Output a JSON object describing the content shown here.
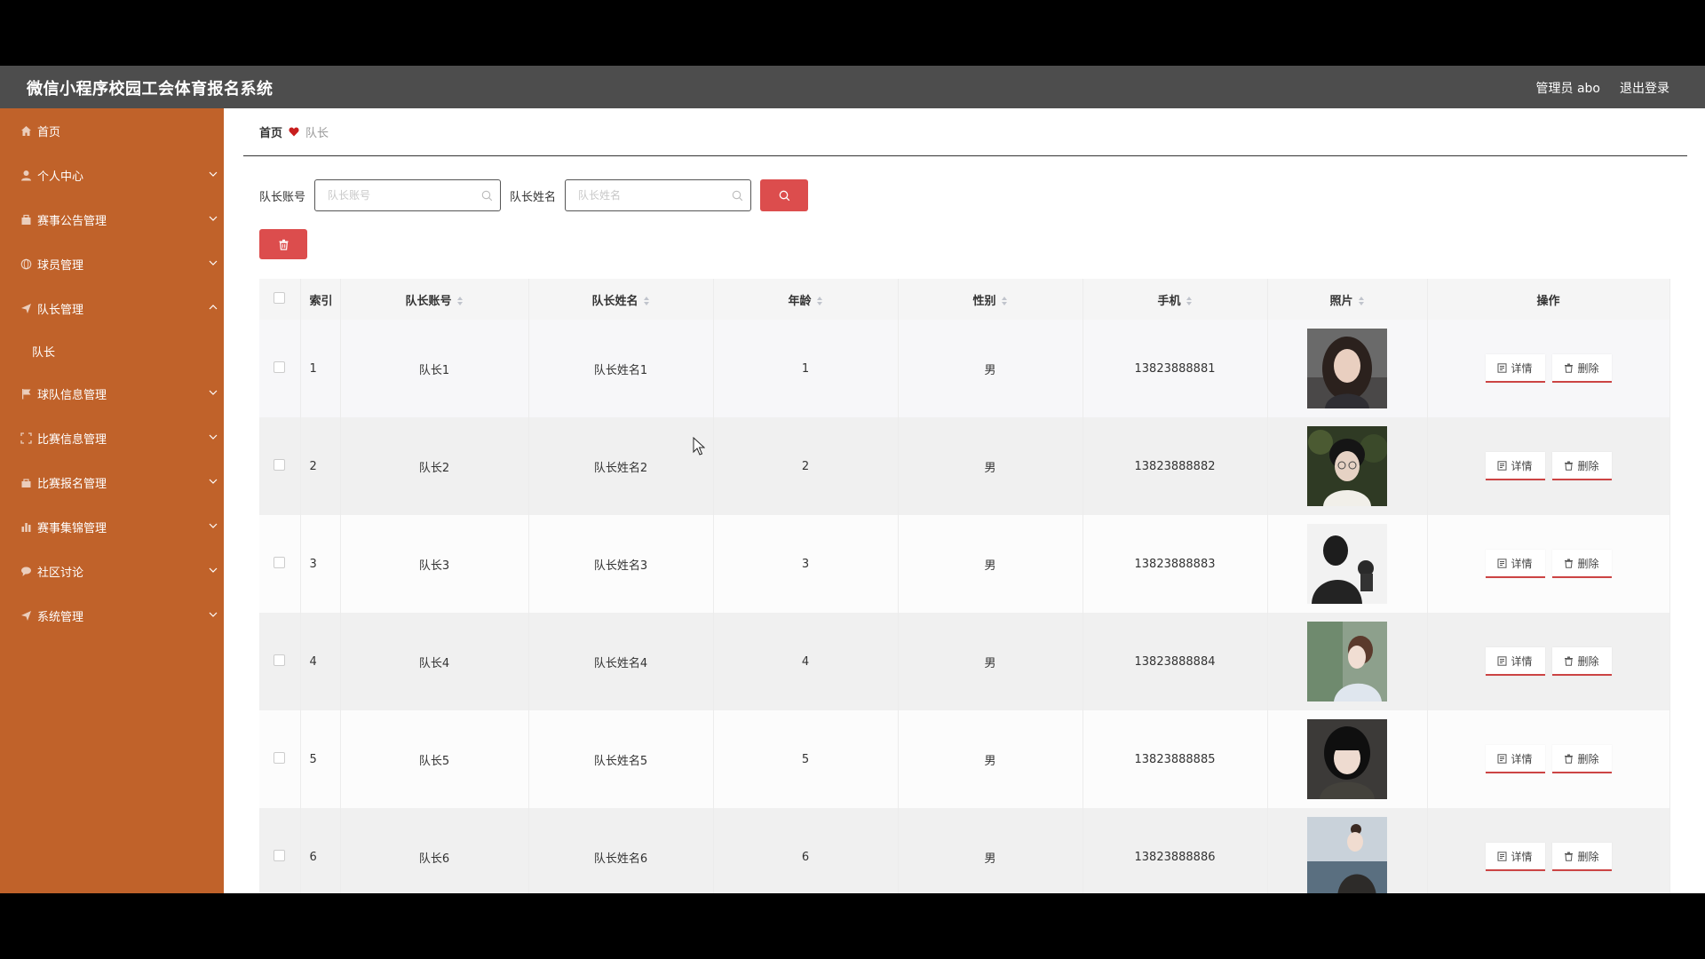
{
  "header": {
    "title": "微信小程序校园工会体育报名系统",
    "admin": "管理员 abo",
    "logout": "退出登录"
  },
  "sidebar": {
    "items": [
      {
        "label": "首页",
        "icon": "home-icon",
        "chevron": false
      },
      {
        "label": "个人中心",
        "icon": "user-icon",
        "chevron": true
      },
      {
        "label": "赛事公告管理",
        "icon": "bag-icon",
        "chevron": true
      },
      {
        "label": "球员管理",
        "icon": "globe-icon",
        "chevron": true
      },
      {
        "label": "队长管理",
        "icon": "send-icon",
        "chevron": true,
        "open": true
      },
      {
        "label": "球队信息管理",
        "icon": "flag-icon",
        "chevron": true
      },
      {
        "label": "比赛信息管理",
        "icon": "fullscreen-icon",
        "chevron": true
      },
      {
        "label": "比赛报名管理",
        "icon": "bag-icon",
        "chevron": true
      },
      {
        "label": "赛事集锦管理",
        "icon": "chart-icon",
        "chevron": true
      },
      {
        "label": "社区讨论",
        "icon": "chat-icon",
        "chevron": true
      },
      {
        "label": "系统管理",
        "icon": "send-icon",
        "chevron": true
      }
    ],
    "sub_item": "队长"
  },
  "breadcrumb": {
    "home": "首页",
    "current": "队长"
  },
  "search": {
    "account_label": "队长账号",
    "account_placeholder": "队长账号",
    "name_label": "队长姓名",
    "name_placeholder": "队长姓名"
  },
  "table": {
    "headers": [
      "索引",
      "队长账号",
      "队长姓名",
      "年龄",
      "性别",
      "手机",
      "照片",
      "操作"
    ],
    "rows": [
      {
        "index": "1",
        "account": "队长1",
        "name": "队长姓名1",
        "age": "1",
        "gender": "男",
        "phone": "13823888881"
      },
      {
        "index": "2",
        "account": "队长2",
        "name": "队长姓名2",
        "age": "2",
        "gender": "男",
        "phone": "13823888882"
      },
      {
        "index": "3",
        "account": "队长3",
        "name": "队长姓名3",
        "age": "3",
        "gender": "男",
        "phone": "13823888883"
      },
      {
        "index": "4",
        "account": "队长4",
        "name": "队长姓名4",
        "age": "4",
        "gender": "男",
        "phone": "13823888884"
      },
      {
        "index": "5",
        "account": "队长5",
        "name": "队长姓名5",
        "age": "5",
        "gender": "男",
        "phone": "13823888885"
      },
      {
        "index": "6",
        "account": "队长6",
        "name": "队长姓名6",
        "age": "6",
        "gender": "男",
        "phone": "13823888886"
      }
    ],
    "detail_label": "详情",
    "delete_label": "删除"
  },
  "colors": {
    "sidebar": "#c0622a",
    "topbar": "#4d4d4d",
    "accent": "#dc4d4d"
  }
}
